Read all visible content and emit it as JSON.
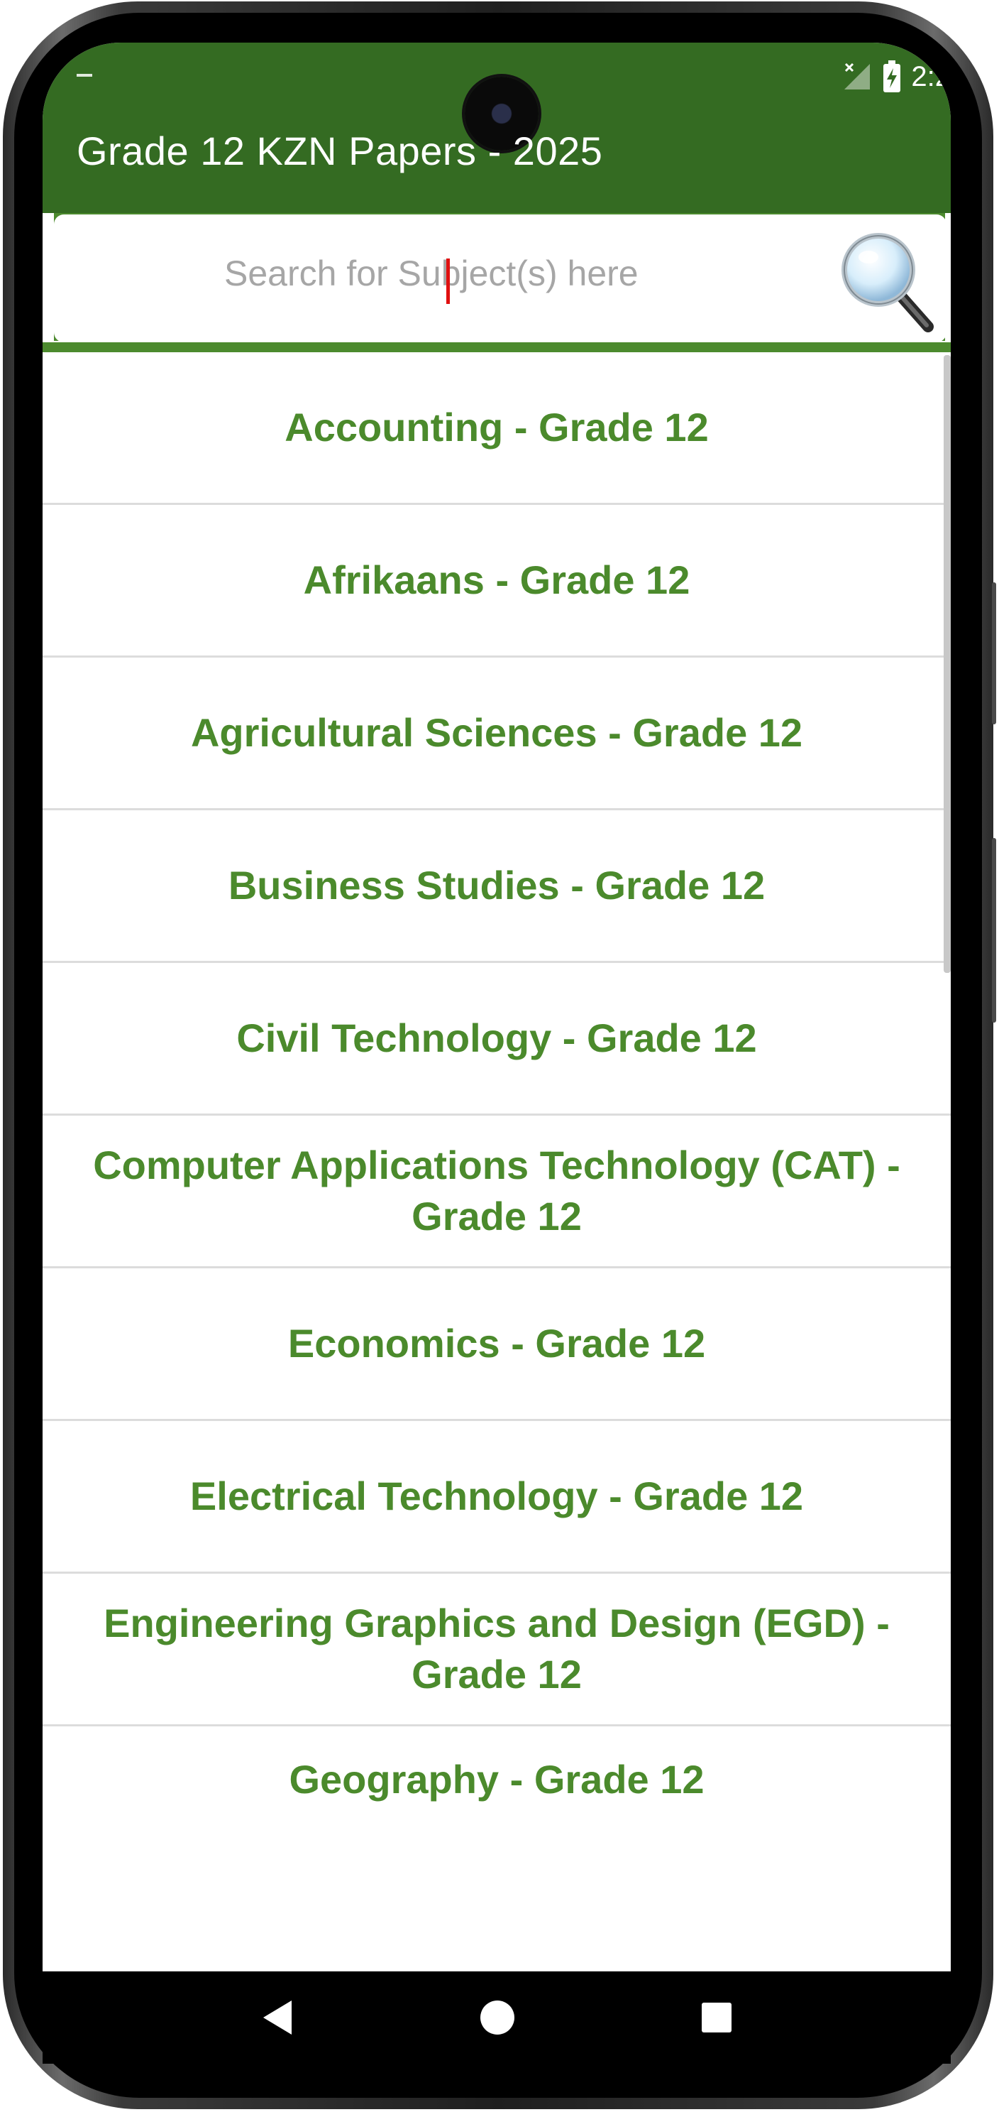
{
  "app": {
    "title": "Grade 12 KZN Papers - 2025"
  },
  "status_bar": {
    "time": "2:2",
    "icons": [
      "no-signal-icon",
      "battery-charging-icon"
    ]
  },
  "search": {
    "placeholder": "Search for Subject(s) here",
    "icon": "magnifier-icon"
  },
  "subjects": [
    "Accounting - Grade 12",
    "Afrikaans - Grade 12",
    "Agricultural Sciences - Grade 12",
    "Business Studies - Grade 12",
    "Civil Technology - Grade 12",
    "Computer Applications Technology (CAT) - Grade 12",
    "Economics - Grade 12",
    "Electrical Technology - Grade 12",
    "Engineering Graphics and Design (EGD) - Grade 12",
    "Geography - Grade 12"
  ],
  "navigation": {
    "icons": [
      "back-icon",
      "home-icon",
      "recents-icon"
    ]
  },
  "colors": {
    "appbar": "#346b22",
    "subject_text": "#4b8a2c",
    "caret": "#e01010"
  }
}
